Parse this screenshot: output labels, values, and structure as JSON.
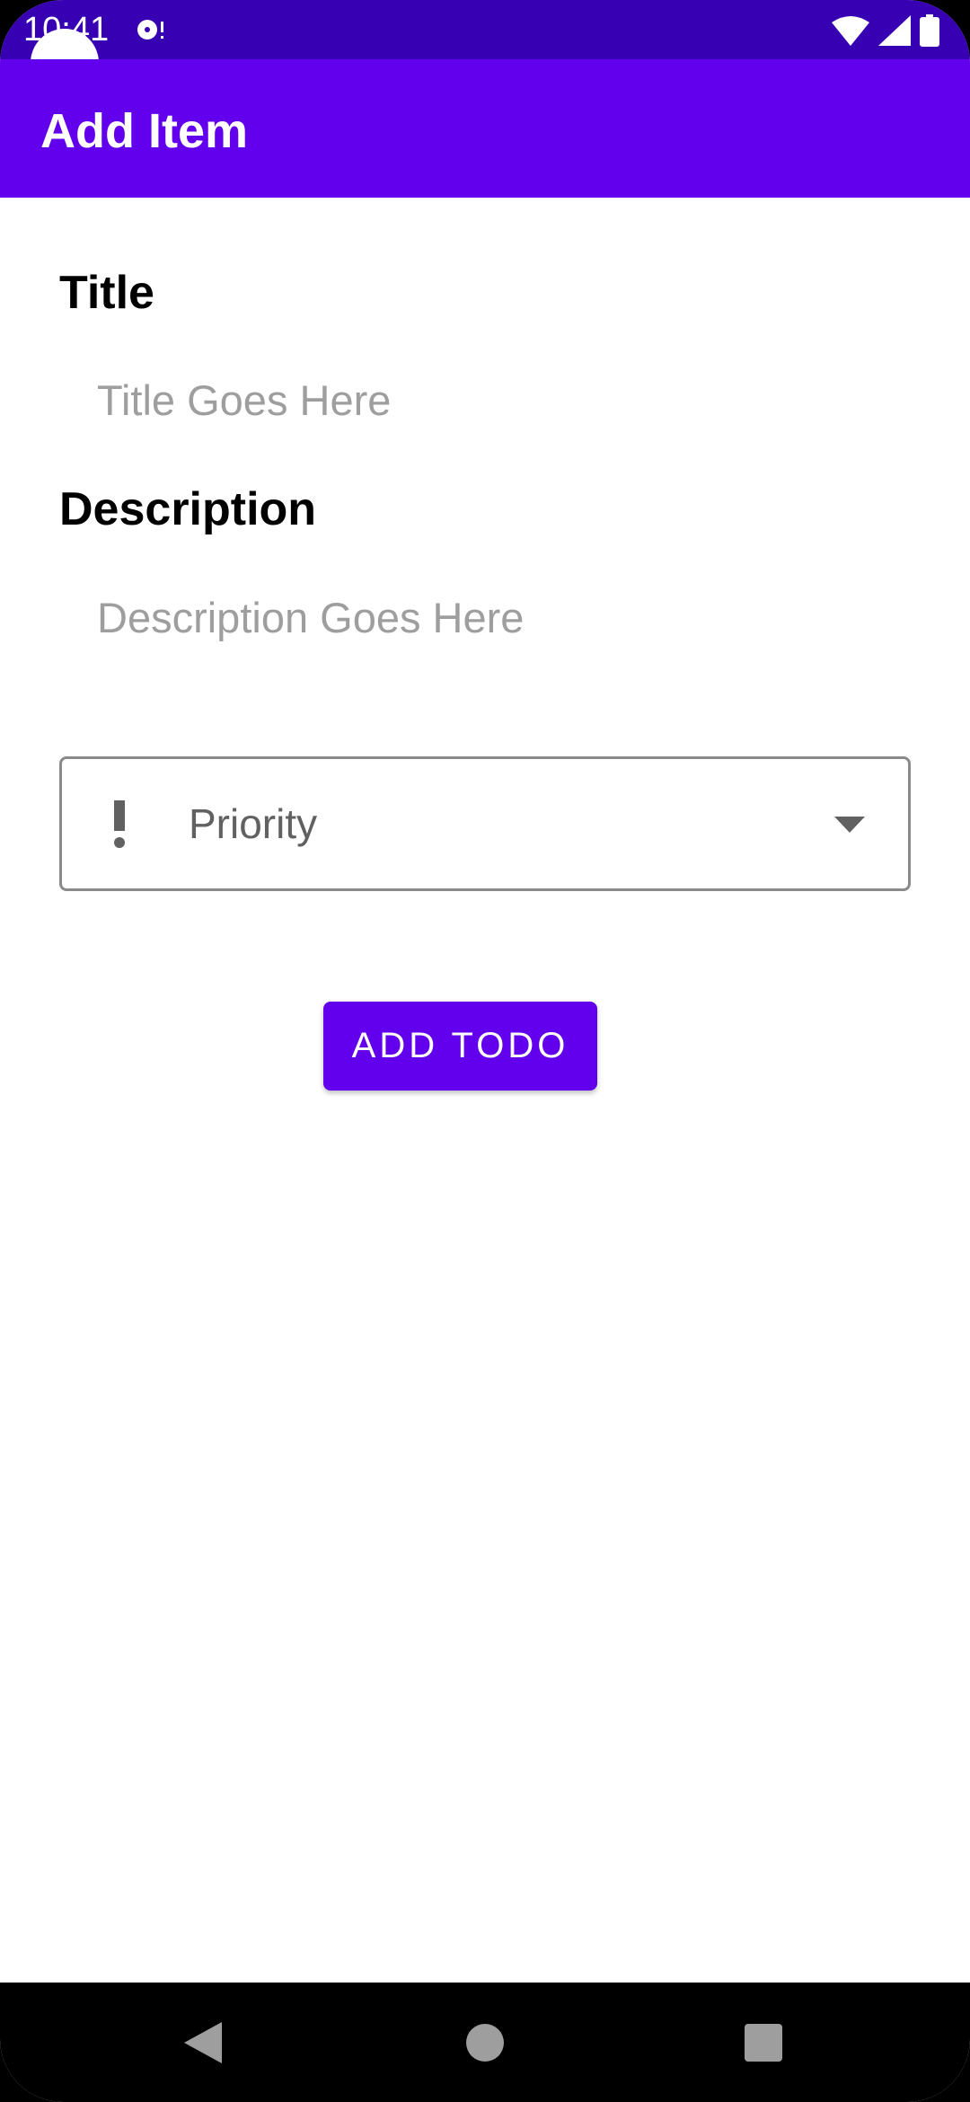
{
  "status_bar": {
    "time": "10:41",
    "icons": [
      "media-notification-icon",
      "wifi-icon",
      "cell-signal-icon",
      "battery-icon"
    ]
  },
  "app_bar": {
    "title": "Add Item"
  },
  "form": {
    "title_label": "Title",
    "title_placeholder": "Title Goes Here",
    "title_value": "",
    "description_label": "Description",
    "description_placeholder": "Description Goes Here",
    "description_value": "",
    "priority": {
      "label": "Priority",
      "icon": "priority-high-icon"
    },
    "add_button_label": "ADD TODO"
  },
  "nav_bar": {
    "icons": [
      "back-icon",
      "home-icon",
      "recents-icon"
    ]
  },
  "colors": {
    "status_bar": "#3700b3",
    "primary": "#6200ee",
    "placeholder": "#9e9e9e",
    "outline": "#8a8a8a"
  }
}
